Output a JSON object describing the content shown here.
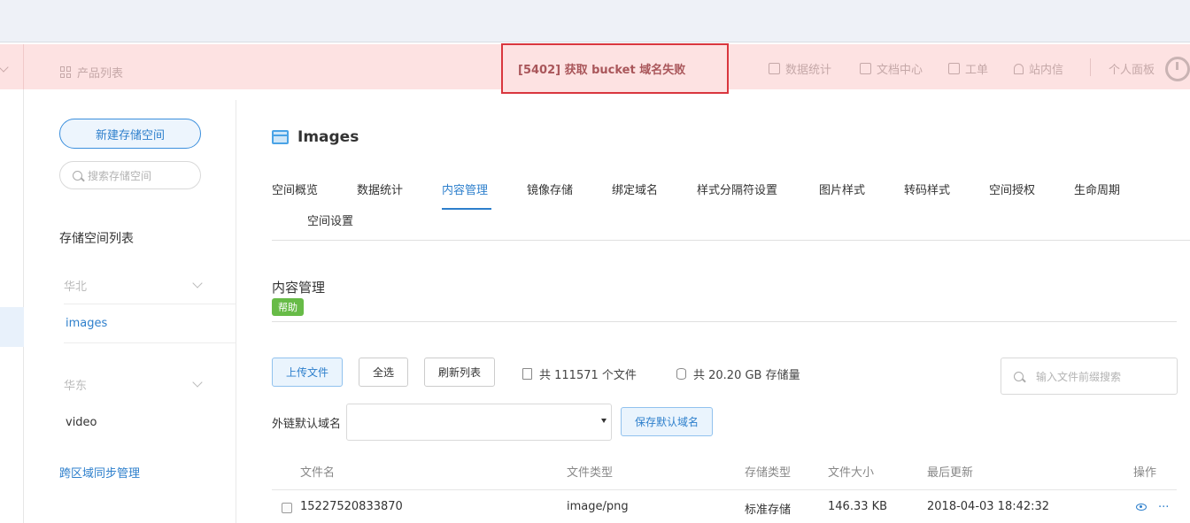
{
  "topbar": {
    "product_list": "产品列表",
    "error_message": "[5402] 获取 bucket 域名失败",
    "nav": [
      {
        "label": "数据统计",
        "icon": "chart-icon"
      },
      {
        "label": "文档中心",
        "icon": "document-icon"
      },
      {
        "label": "工单",
        "icon": "clipboard-icon"
      },
      {
        "label": "站内信",
        "icon": "bell-icon"
      }
    ],
    "personal_panel": "个人面板"
  },
  "sidebar": {
    "new_bucket_button": "新建存储空间",
    "search_placeholder": "搜索存储空间",
    "list_title": "存储空间列表",
    "regions": [
      {
        "name": "华北",
        "buckets": [
          "images"
        ]
      },
      {
        "name": "华东",
        "buckets": [
          "video"
        ]
      }
    ],
    "cross_region_link": "跨区域同步管理"
  },
  "main": {
    "bucket_title": "Images",
    "tabs": [
      {
        "label": "空间概览"
      },
      {
        "label": "数据统计"
      },
      {
        "label": "内容管理",
        "active": true
      },
      {
        "label": "镜像存储"
      },
      {
        "label": "绑定域名"
      },
      {
        "label": "样式分隔符设置"
      },
      {
        "label": "图片样式"
      },
      {
        "label": "转码样式"
      },
      {
        "label": "空间授权"
      },
      {
        "label": "生命周期"
      },
      {
        "label": "空间设置"
      }
    ],
    "section_title": "内容管理",
    "help_badge": "帮助",
    "toolbar": {
      "upload": "上传文件",
      "select_all": "全选",
      "refresh": "刷新列表",
      "file_count": "共 111571 个文件",
      "storage_total": "共 20.20 GB 存储量",
      "search_placeholder": "输入文件前缀搜索"
    },
    "domain": {
      "label": "外链默认域名",
      "value": "",
      "save_button": "保存默认域名"
    },
    "table": {
      "columns": [
        "文件名",
        "文件类型",
        "存储类型",
        "文件大小",
        "最后更新",
        "操作"
      ],
      "rows": [
        {
          "name": "15227520833870",
          "type": "image/png",
          "storage": "标准存储",
          "size": "146.33 KB",
          "updated": "2018-04-03 18:42:32",
          "more": "···"
        }
      ]
    }
  },
  "colors": {
    "accent": "#2d7fcc",
    "error_bar": "#fde2e2",
    "error_border": "#d9363e",
    "help_badge": "#67bb47"
  }
}
